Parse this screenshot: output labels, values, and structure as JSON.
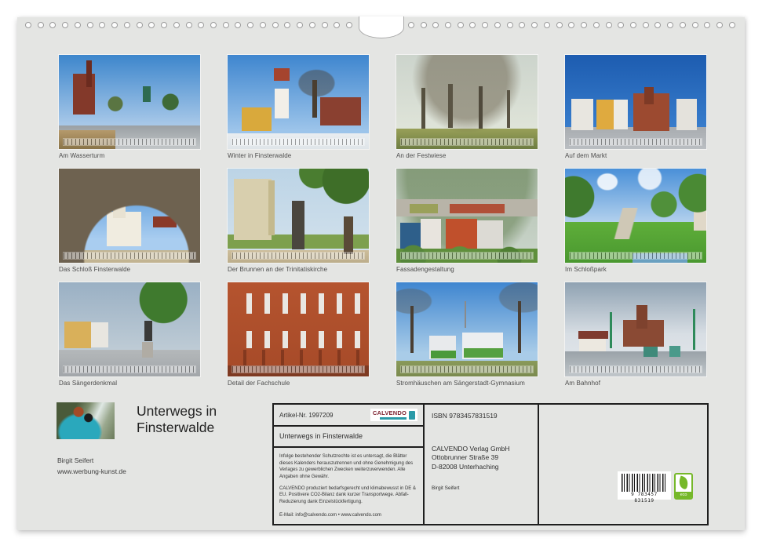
{
  "header": {
    "title": "Unterwegs in Finsterwalde",
    "author": "Birgit Seifert",
    "website": "www.werbung-kunst.de"
  },
  "photos": [
    {
      "caption": "Am Wasserturm"
    },
    {
      "caption": "Winter in Finsterwalde"
    },
    {
      "caption": "An der Festwiese"
    },
    {
      "caption": "Auf dem Markt"
    },
    {
      "caption": "Das Schloß Finsterwalde"
    },
    {
      "caption": "Der Brunnen an der Trinitatiskirche"
    },
    {
      "caption": "Fassadengestaltung"
    },
    {
      "caption": "Im Schloßpark"
    },
    {
      "caption": "Das Sängerdenkmal"
    },
    {
      "caption": "Detail der Fachschule"
    },
    {
      "caption": "Stromhäuschen am Sängerstadt-Gymnasium"
    },
    {
      "caption": "Am Bahnhof"
    }
  ],
  "info_box": {
    "article_no": "Artikel-Nr. 1997209",
    "logo_text": "CALVENDO",
    "box_title": "Unterwegs in Finsterwalde",
    "legal_1": "Infolge bestehender Schutzrechte ist es untersagt, die Blätter dieses Kalenders herauszutrennen und ohne Genehmigung des Verlages zu gewerblichen Zwecken weiterzuverwenden. Alle Angaben ohne Gewähr.",
    "legal_2": "CALVENDO produziert bedarfsgerecht und klimabewusst in DE & EU. Positivere CO2-Bilanz dank kurzer Transportwege. Abfall-Reduzierung dank Einzelstückfertigung.",
    "contact": "E-Mail: info@calvendo.com • www.calvendo.com",
    "isbn": "ISBN 9783457831519",
    "publisher_line1": "CALVENDO Verlag GmbH",
    "publisher_line2": "Ottobrunner Straße 39",
    "publisher_line3": "D-82008 Unterhaching",
    "author_credit": "Birgit Seifert",
    "barcode_digits": "9 783457 831519",
    "eco_label": "eco"
  },
  "binding": {
    "hole_count": 58
  },
  "colors": {
    "page_bg": "#e4e5e3",
    "eco_green": "#76b82a",
    "logo_maroon": "#7d2230",
    "logo_teal": "#2a9aa8"
  }
}
